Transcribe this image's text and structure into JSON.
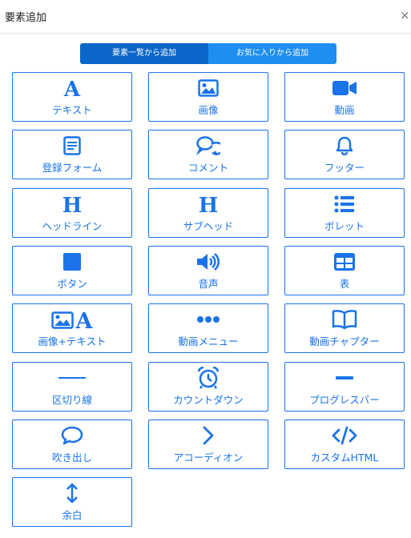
{
  "header": {
    "title": "要素追加",
    "close_label": "×"
  },
  "tabs": [
    {
      "label": "要素一覧から追加",
      "active": true
    },
    {
      "label": "お気に入りから追加",
      "active": false
    }
  ],
  "accent_color": "#1a73e8",
  "elements": [
    {
      "label": "テキスト",
      "icon": "text-a-icon"
    },
    {
      "label": "画像",
      "icon": "image-icon"
    },
    {
      "label": "動画",
      "icon": "video-camera-icon"
    },
    {
      "label": "登録フォーム",
      "icon": "form-icon"
    },
    {
      "label": "コメント",
      "icon": "comments-icon"
    },
    {
      "label": "フッター",
      "icon": "bell-icon"
    },
    {
      "label": "ヘッドライン",
      "icon": "heading-icon"
    },
    {
      "label": "サブヘッド",
      "icon": "subheading-icon"
    },
    {
      "label": "ボレット",
      "icon": "list-icon"
    },
    {
      "label": "ボタン",
      "icon": "square-icon"
    },
    {
      "label": "音声",
      "icon": "volume-icon"
    },
    {
      "label": "表",
      "icon": "table-icon"
    },
    {
      "label": "画像+テキスト",
      "icon": "image-text-icon"
    },
    {
      "label": "動画メニュー",
      "icon": "ellipsis-icon"
    },
    {
      "label": "動画チャプター",
      "icon": "book-open-icon"
    },
    {
      "label": "区切り線",
      "icon": "divider-line-icon"
    },
    {
      "label": "カウントダウン",
      "icon": "alarm-clock-icon"
    },
    {
      "label": "プログレスバー",
      "icon": "minus-icon"
    },
    {
      "label": "吹き出し",
      "icon": "speech-bubble-icon"
    },
    {
      "label": "アコーディオン",
      "icon": "chevron-right-icon"
    },
    {
      "label": "カスタムHTML",
      "icon": "code-icon"
    },
    {
      "label": "余白",
      "icon": "vertical-arrows-icon"
    }
  ]
}
